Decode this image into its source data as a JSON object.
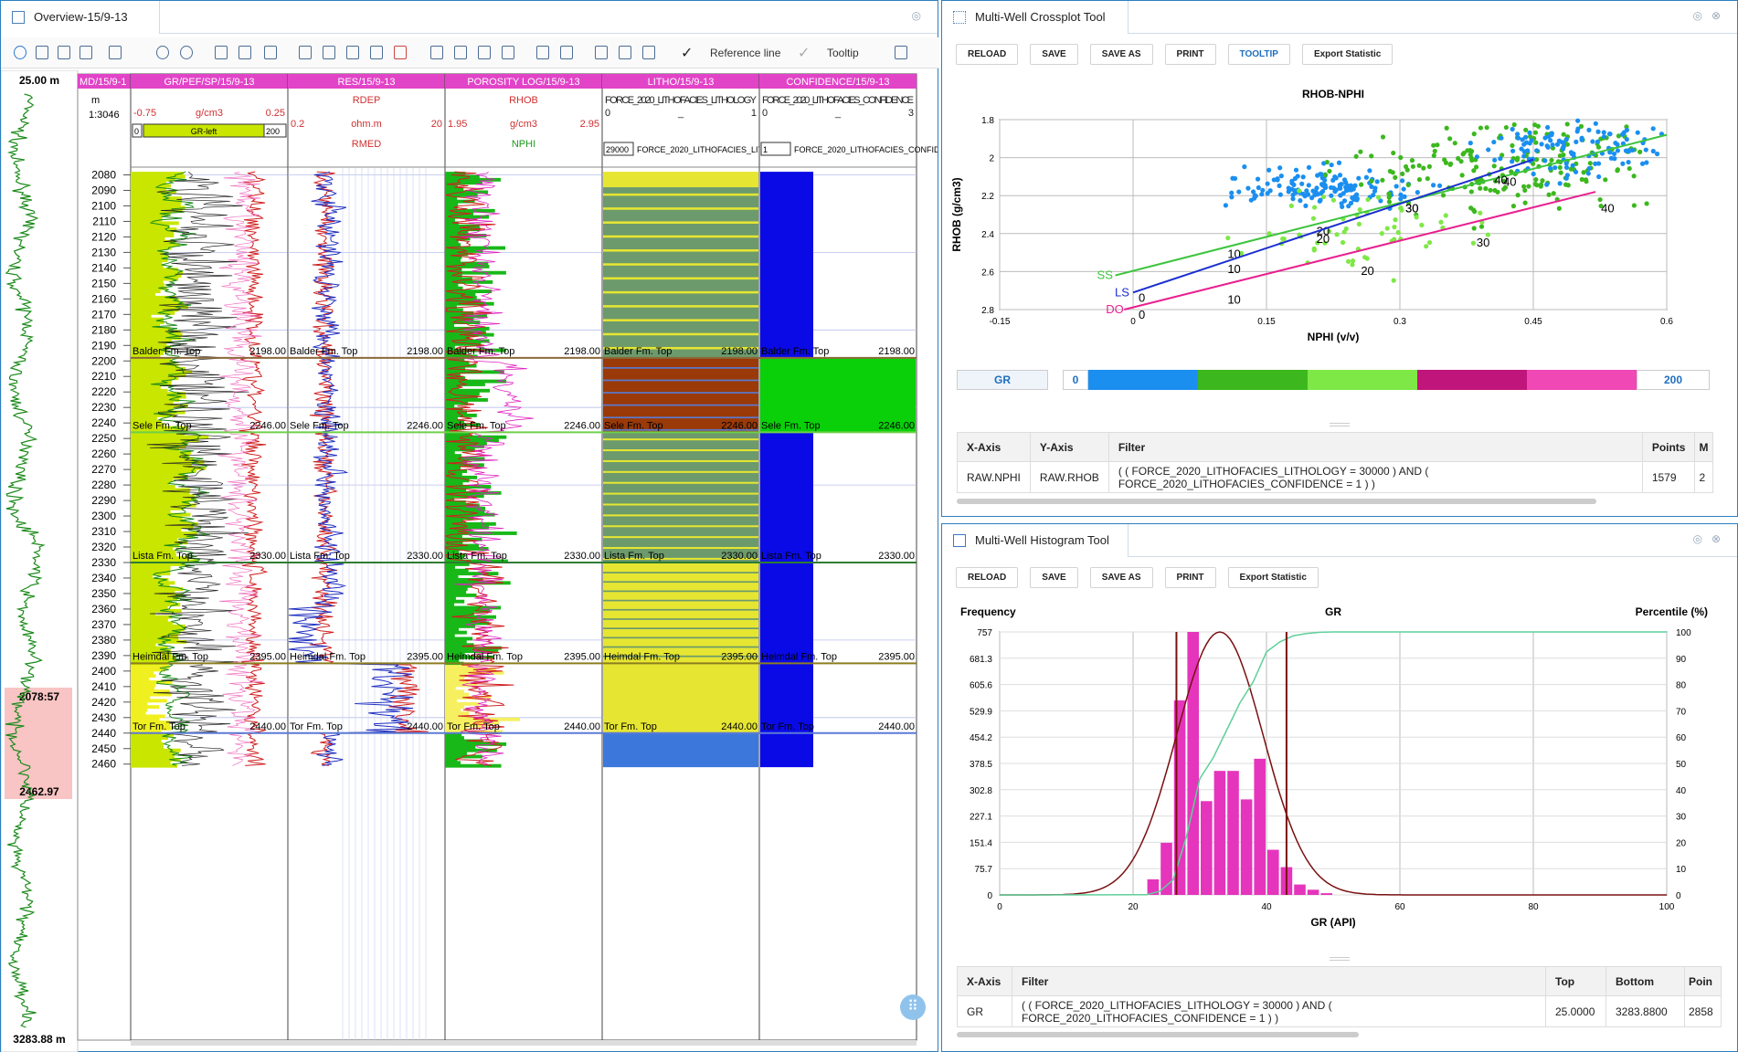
{
  "left": {
    "tab": "Overview-15/9-13",
    "toolbar": {
      "ref_line": "Reference line",
      "tooltip": "Tooltip"
    },
    "overview": {
      "top": "25.00 m",
      "bottom": "3283.88 m",
      "sel_top": "2078:57",
      "sel_bottom": "2462.97"
    },
    "depth_track": {
      "header": "MD/15/9-1",
      "unit": "m",
      "scale": "1:3046"
    },
    "tracks": [
      {
        "title": "GR/PEF/SP/15/9-13",
        "curve": "",
        "min": "-0.75",
        "unit": "g/cm3",
        "max": "0.25",
        "box1": "0",
        "fill": "GR-left",
        "box2": "200"
      },
      {
        "title": "RES/15/9-13",
        "curve": "RDEP",
        "min": "0.2",
        "unit": "ohm.m",
        "max": "20",
        "curve2": "RMED"
      },
      {
        "title": "POROSITY LOG/15/9-13",
        "curve": "RHOB",
        "min": "1.95",
        "unit": "g/cm3",
        "max": "2.95",
        "curve2": "NPHI"
      },
      {
        "title": "LITHO/15/9-13",
        "curve": "FORCE_2020_LITHOFACIES_LITHOLOGY",
        "min": "0",
        "unit": "_",
        "max": "1",
        "box1": "29000",
        "box2": "FORCE_2020_LITHOFACIES_LITHOLOGY"
      },
      {
        "title": "CONFIDENCE/15/9-13",
        "curve": "FORCE_2020_LITHOFACIES_CONFIDENCE",
        "min": "0",
        "unit": "_",
        "max": "3",
        "box1": "1",
        "box2": "FORCE_2020_LITHOFACIES_CONFIDENCE"
      }
    ],
    "depths": [
      "2080",
      "2090",
      "2100",
      "2110",
      "2120",
      "2130",
      "2140",
      "2150",
      "2160",
      "2170",
      "2180",
      "2190",
      "2200",
      "2210",
      "2220",
      "2230",
      "2240",
      "2250",
      "2260",
      "2270",
      "2280",
      "2290",
      "2300",
      "2310",
      "2320",
      "2330",
      "2340",
      "2350",
      "2360",
      "2370",
      "2380",
      "2390",
      "2400",
      "2410",
      "2420",
      "2430",
      "2440",
      "2450",
      "2460"
    ],
    "formations": [
      {
        "name": "Balder Fm. Top",
        "depth": "2198.00",
        "color": "#8b6a3a"
      },
      {
        "name": "Sele Fm. Top",
        "depth": "2246.00",
        "color": "#6fd04a"
      },
      {
        "name": "Lista Fm. Top",
        "depth": "2330.00",
        "color": "#2e7d32"
      },
      {
        "name": "Heimdal Fm. Top",
        "depth": "2395.00",
        "color": "#8b7d20"
      },
      {
        "name": "Tor Fm. Top",
        "depth": "2440.00",
        "color": "#5b7bd5"
      }
    ]
  },
  "crossplot": {
    "tab": "Multi-Well Crossplot Tool",
    "buttons": [
      "RELOAD",
      "SAVE",
      "SAVE AS",
      "PRINT",
      "TOOLTIP",
      "Export Statistic"
    ],
    "colorbar": {
      "name": "GR",
      "min": "0",
      "max": "200",
      "colors": [
        "#1a8ff0",
        "#3cb81e",
        "#7ee846",
        "#c0157a",
        "#f048b5"
      ]
    },
    "table": {
      "headers": [
        "X-Axis",
        "Y-Axis",
        "Filter",
        "Points",
        "M"
      ],
      "row": [
        "RAW.NPHI",
        "RAW.RHOB",
        "( ( FORCE_2020_LITHOFACIES_LITHOLOGY = 30000 ) AND ( FORCE_2020_LITHOFACIES_CONFIDENCE = 1 ) )",
        "1579",
        "2"
      ]
    }
  },
  "histogram": {
    "tab": "Multi-Well Histogram Tool",
    "buttons": [
      "RELOAD",
      "SAVE",
      "SAVE AS",
      "PRINT",
      "Export Statistic"
    ],
    "table": {
      "headers": [
        "X-Axis",
        "Filter",
        "Top",
        "Bottom",
        "Poin"
      ],
      "row": [
        "GR",
        "( ( FORCE_2020_LITHOFACIES_LITHOLOGY = 30000 ) AND ( FORCE_2020_LITHOFACIES_CONFIDENCE = 1 ) )",
        "25.0000",
        "3283.8800",
        "2858"
      ]
    }
  },
  "chart_data": [
    {
      "type": "scatter",
      "title": "RHOB-NPHI",
      "xlabel": "NPHI (v/v)",
      "ylabel": "RHOB (g/cm3)",
      "xlim": [
        -0.15,
        0.6
      ],
      "ylim": [
        1.8,
        2.8
      ],
      "y_inverted": true,
      "grid": true,
      "xticks": [
        "-0.15",
        "0",
        "0.15",
        "0.3",
        "0.45",
        "0.6"
      ],
      "yticks": [
        "1.8",
        "2",
        "2.2",
        "2.4",
        "2.6",
        "2.8"
      ],
      "clusters": [
        {
          "color": "#1a8ff0",
          "cx": 0.22,
          "cy": 2.16,
          "sx": 0.05,
          "sy": 0.05,
          "n": 150
        },
        {
          "color": "#3cb81e",
          "cx": 0.42,
          "cy": 2.05,
          "sx": 0.08,
          "sy": 0.12,
          "n": 200
        },
        {
          "color": "#7ee846",
          "cx": 0.25,
          "cy": 2.4,
          "sx": 0.06,
          "sy": 0.1,
          "n": 60
        },
        {
          "color": "#1a8ff0",
          "cx": 0.5,
          "cy": 1.95,
          "sx": 0.05,
          "sy": 0.08,
          "n": 120
        }
      ],
      "lines": [
        {
          "name": "SS",
          "color": "#3cc43c",
          "x": [
            -0.02,
            0.6
          ],
          "y": [
            2.62,
            1.88
          ],
          "ticks": [
            [
              "10",
              0.1,
              2.48
            ],
            [
              "20",
              0.2,
              2.36
            ],
            [
              "30",
              0.3,
              2.24
            ],
            [
              "40",
              0.41,
              2.1
            ]
          ]
        },
        {
          "name": "LS",
          "color": "#1a2fd0",
          "x": [
            0.0,
            0.45
          ],
          "y": [
            2.71,
            2.01
          ],
          "ticks": [
            [
              "0",
              0.0,
              2.71
            ],
            [
              "10",
              0.1,
              2.56
            ],
            [
              "20",
              0.2,
              2.4
            ],
            [
              "30",
              0.3,
              2.24
            ],
            [
              "40",
              0.4,
              2.09
            ]
          ]
        },
        {
          "name": "DO",
          "color": "#e8208f",
          "x": [
            -0.01,
            0.52
          ],
          "y": [
            2.8,
            2.18
          ],
          "ticks": [
            [
              "0",
              0.0,
              2.8
            ],
            [
              "10",
              0.1,
              2.72
            ],
            [
              "20",
              0.25,
              2.57
            ],
            [
              "30",
              0.38,
              2.42
            ],
            [
              "40",
              0.52,
              2.24
            ]
          ]
        }
      ]
    },
    {
      "type": "bar",
      "title": "GR",
      "xlabel": "GR (API)",
      "ylabel": "Frequency",
      "y2label": "Percentile (%)",
      "xlim": [
        0,
        100
      ],
      "ylim": [
        0,
        757
      ],
      "y2lim": [
        0,
        100
      ],
      "xticks": [
        "0",
        "20",
        "40",
        "60",
        "80",
        "100"
      ],
      "yticks": [
        "0",
        "75.7",
        "151.4",
        "227.1",
        "302.8",
        "378.5",
        "454.2",
        "529.9",
        "605.6",
        "681.3",
        "757"
      ],
      "y2ticks": [
        "0",
        "10",
        "20",
        "30",
        "40",
        "50",
        "60",
        "70",
        "80",
        "90",
        "100"
      ],
      "bins": [
        [
          20,
          22,
          2
        ],
        [
          22,
          24,
          45
        ],
        [
          24,
          26,
          150
        ],
        [
          26,
          28,
          560
        ],
        [
          28,
          30,
          757
        ],
        [
          30,
          32,
          270
        ],
        [
          32,
          34,
          357
        ],
        [
          34,
          36,
          357
        ],
        [
          36,
          38,
          275
        ],
        [
          38,
          40,
          392
        ],
        [
          40,
          42,
          130
        ],
        [
          42,
          44,
          80
        ],
        [
          44,
          46,
          30
        ],
        [
          46,
          48,
          15
        ],
        [
          48,
          50,
          5
        ]
      ],
      "normal": {
        "mean": 33,
        "sd": 6.5,
        "peak": 757
      },
      "cutoffs": [
        26.5,
        43
      ]
    }
  ]
}
